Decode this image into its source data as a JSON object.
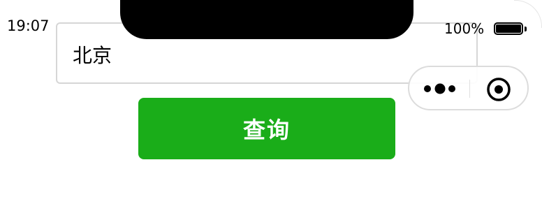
{
  "status_bar": {
    "time": "19:07",
    "battery_percent": "100%",
    "battery_level": 1.0
  },
  "search": {
    "value": "北京",
    "placeholder": ""
  },
  "capsule": {
    "more_icon": "more-dots-icon",
    "close_icon": "close-target-icon"
  },
  "actions": {
    "query_label": "查询"
  },
  "colors": {
    "primary": "#1aad19",
    "border": "#d6d6d6",
    "text": "#000000"
  }
}
